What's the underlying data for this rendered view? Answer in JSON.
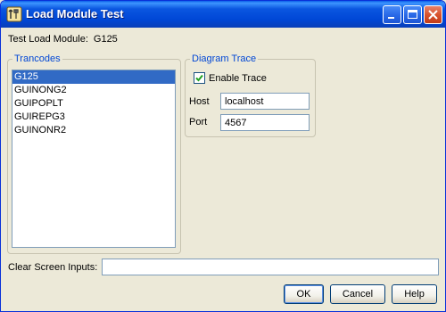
{
  "window": {
    "title": "Load Module Test",
    "icon": "tools-icon",
    "controls": {
      "minimize": "minimize-icon",
      "maximize": "maximize-icon",
      "close": "close-icon"
    }
  },
  "module": {
    "label": "Test Load Module:",
    "value": "G125"
  },
  "trancodes": {
    "title": "Trancodes",
    "items": [
      "G125",
      "GUINONG2",
      "GUIPOPLT",
      "GUIREPG3",
      "GUINONR2"
    ],
    "selected": "G125"
  },
  "diagram_trace": {
    "title": "Diagram Trace",
    "enable_label": "Enable Trace",
    "enable_checked": true,
    "host_label": "Host",
    "host_value": "localhost",
    "port_label": "Port",
    "port_value": "4567"
  },
  "clear_screen": {
    "label": "Clear Screen Inputs:",
    "value": ""
  },
  "buttons": {
    "ok": "OK",
    "cancel": "Cancel",
    "help": "Help"
  },
  "colors": {
    "titlebar": "#0a56e0",
    "selection": "#316ac5",
    "group_title": "#0046d5",
    "dialog_bg": "#ece9d8"
  }
}
